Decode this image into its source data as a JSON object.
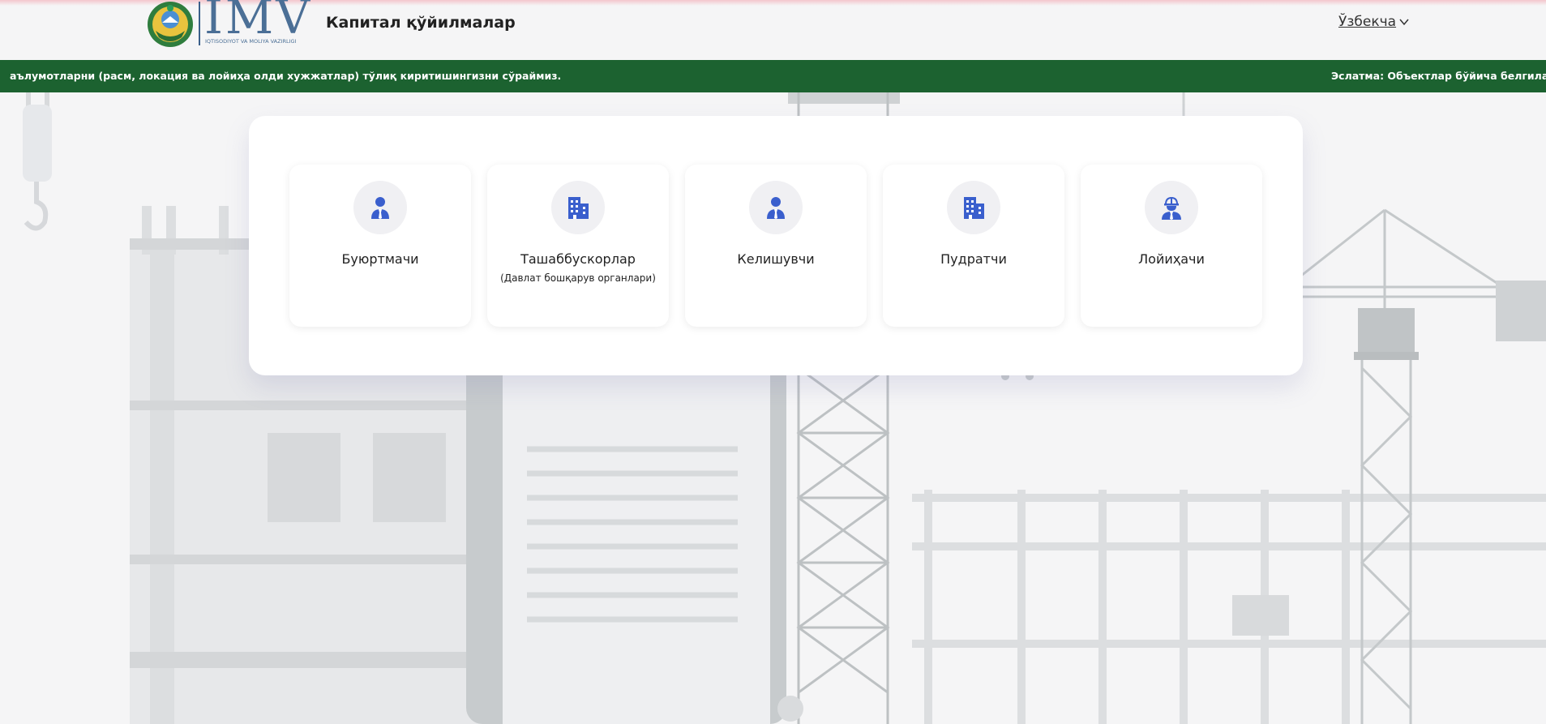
{
  "header": {
    "logo_text": "IMV",
    "logo_subtitle": "IQTISODIYOT VA MOLIYA VAZIRLIGI",
    "title": "Капитал қўйилмалар",
    "language": "Ўзбекча"
  },
  "ticker": {
    "text_left": "аълумотларни (расм, локация ва лойиҳа олди хужжатлар) тўлиқ киритишингизни сўраймиз.",
    "text_right": "Эслатма: Объектлар бўйича белгиланган м"
  },
  "roles": [
    {
      "label": "Буюртмачи",
      "sublabel": "",
      "icon": "user-tie-icon"
    },
    {
      "label": "Ташаббускорлар",
      "sublabel": "(Давлат бошқарув органлари)",
      "icon": "building-icon"
    },
    {
      "label": "Келишувчи",
      "sublabel": "",
      "icon": "user-tie-icon"
    },
    {
      "label": "Пудратчи",
      "sublabel": "",
      "icon": "building-icon"
    },
    {
      "label": "Лойиҳачи",
      "sublabel": "",
      "icon": "engineer-helmet-icon"
    }
  ],
  "colors": {
    "accent": "#3a5fcd",
    "ticker_bg": "#1c6230",
    "background": "#f5f5f6"
  }
}
